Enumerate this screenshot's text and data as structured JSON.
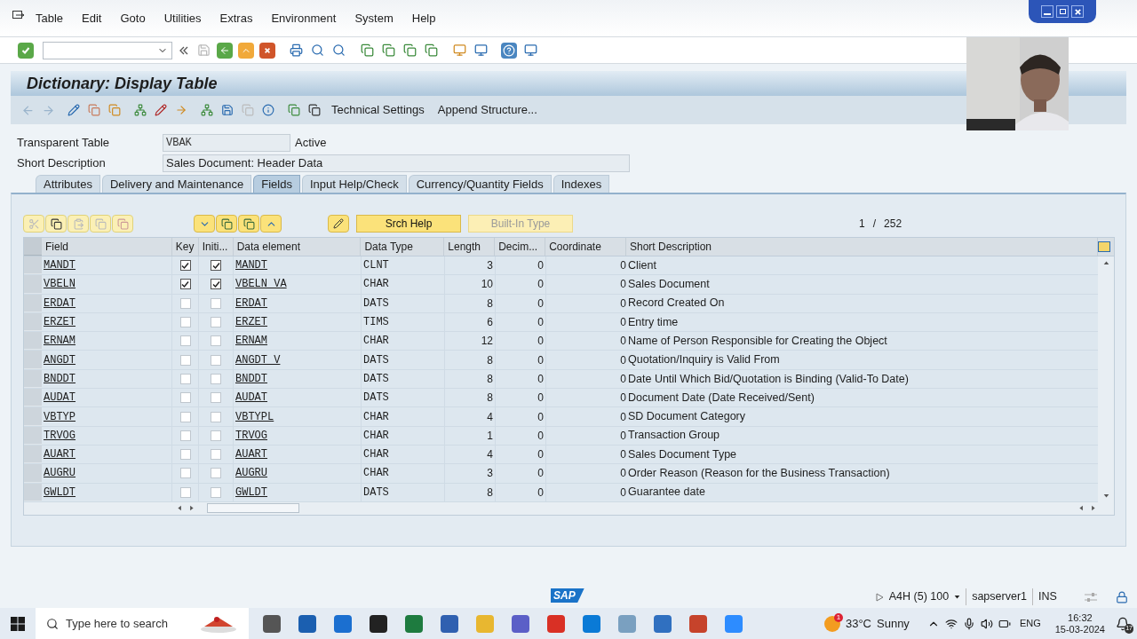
{
  "menu": [
    "Table",
    "Edit",
    "Goto",
    "Utilities",
    "Extras",
    "Environment",
    "System",
    "Help"
  ],
  "title": "Dictionary: Display Table",
  "app_toolbar": {
    "buttons": [
      "Technical Settings",
      "Append Structure..."
    ]
  },
  "header": {
    "table_label": "Transparent Table",
    "table_value": "VBAK",
    "table_status": "Active",
    "description_label": "Short Description",
    "description_value": "Sales Document: Header Data"
  },
  "tabs": [
    {
      "label": "Attributes",
      "selected": false
    },
    {
      "label": "Delivery and Maintenance",
      "selected": false
    },
    {
      "label": "Fields",
      "selected": true
    },
    {
      "label": "Input Help/Check",
      "selected": false
    },
    {
      "label": "Currency/Quantity Fields",
      "selected": false
    },
    {
      "label": "Indexes",
      "selected": false
    }
  ],
  "table_toolbar": {
    "buttons": [
      {
        "label": "Srch Help",
        "disabled": false
      },
      {
        "label": "Built-In Type",
        "disabled": true
      }
    ],
    "page": "1",
    "separator": "/",
    "total": "252"
  },
  "table": {
    "columns": [
      "Field",
      "Key",
      "Initi...",
      "Data element",
      "Data Type",
      "Length",
      "Decim...",
      "Coordinate",
      "Short Description"
    ],
    "rows": [
      {
        "field": "MANDT",
        "key": true,
        "initial": true,
        "data_element": "MANDT",
        "data_type": "CLNT",
        "length": "3",
        "decimals": "0",
        "coordinate": "0",
        "description": "Client"
      },
      {
        "field": "VBELN",
        "key": true,
        "initial": true,
        "data_element": "VBELN_VA",
        "data_type": "CHAR",
        "length": "10",
        "decimals": "0",
        "coordinate": "0",
        "description": "Sales Document"
      },
      {
        "field": "ERDAT",
        "key": false,
        "initial": false,
        "data_element": "ERDAT",
        "data_type": "DATS",
        "length": "8",
        "decimals": "0",
        "coordinate": "0",
        "description": "Record Created On"
      },
      {
        "field": "ERZET",
        "key": false,
        "initial": false,
        "data_element": "ERZET",
        "data_type": "TIMS",
        "length": "6",
        "decimals": "0",
        "coordinate": "0",
        "description": "Entry time"
      },
      {
        "field": "ERNAM",
        "key": false,
        "initial": false,
        "data_element": "ERNAM",
        "data_type": "CHAR",
        "length": "12",
        "decimals": "0",
        "coordinate": "0",
        "description": "Name of Person Responsible for Creating the Object"
      },
      {
        "field": "ANGDT",
        "key": false,
        "initial": false,
        "data_element": "ANGDT_V",
        "data_type": "DATS",
        "length": "8",
        "decimals": "0",
        "coordinate": "0",
        "description": "Quotation/Inquiry is Valid From"
      },
      {
        "field": "BNDDT",
        "key": false,
        "initial": false,
        "data_element": "BNDDT",
        "data_type": "DATS",
        "length": "8",
        "decimals": "0",
        "coordinate": "0",
        "description": "Date Until Which Bid/Quotation is Binding (Valid-To Date)"
      },
      {
        "field": "AUDAT",
        "key": false,
        "initial": false,
        "data_element": "AUDAT",
        "data_type": "DATS",
        "length": "8",
        "decimals": "0",
        "coordinate": "0",
        "description": "Document Date (Date Received/Sent)"
      },
      {
        "field": "VBTYP",
        "key": false,
        "initial": false,
        "data_element": "VBTYPL",
        "data_type": "CHAR",
        "length": "4",
        "decimals": "0",
        "coordinate": "0",
        "description": "SD Document Category"
      },
      {
        "field": "TRVOG",
        "key": false,
        "initial": false,
        "data_element": "TRVOG",
        "data_type": "CHAR",
        "length": "1",
        "decimals": "0",
        "coordinate": "0",
        "description": "Transaction Group"
      },
      {
        "field": "AUART",
        "key": false,
        "initial": false,
        "data_element": "AUART",
        "data_type": "CHAR",
        "length": "4",
        "decimals": "0",
        "coordinate": "0",
        "description": "Sales Document Type"
      },
      {
        "field": "AUGRU",
        "key": false,
        "initial": false,
        "data_element": "AUGRU",
        "data_type": "CHAR",
        "length": "3",
        "decimals": "0",
        "coordinate": "0",
        "description": "Order Reason (Reason for the Business Transaction)"
      },
      {
        "field": "GWLDT",
        "key": false,
        "initial": false,
        "data_element": "GWLDT",
        "data_type": "DATS",
        "length": "8",
        "decimals": "0",
        "coordinate": "0",
        "description": "Guarantee date"
      }
    ]
  },
  "status_bar": {
    "logo": "SAP",
    "system": "A4H (5) 100",
    "server": "sapserver1",
    "mode": "INS"
  },
  "taskbar": {
    "search_placeholder": "Type here to search",
    "weather_badge": "1",
    "temperature": "33°C",
    "weather": "Sunny",
    "language": "ENG",
    "time": "16:32",
    "date": "15-03-2024",
    "notifications": "17"
  },
  "video": {
    "kind": "picture"
  }
}
